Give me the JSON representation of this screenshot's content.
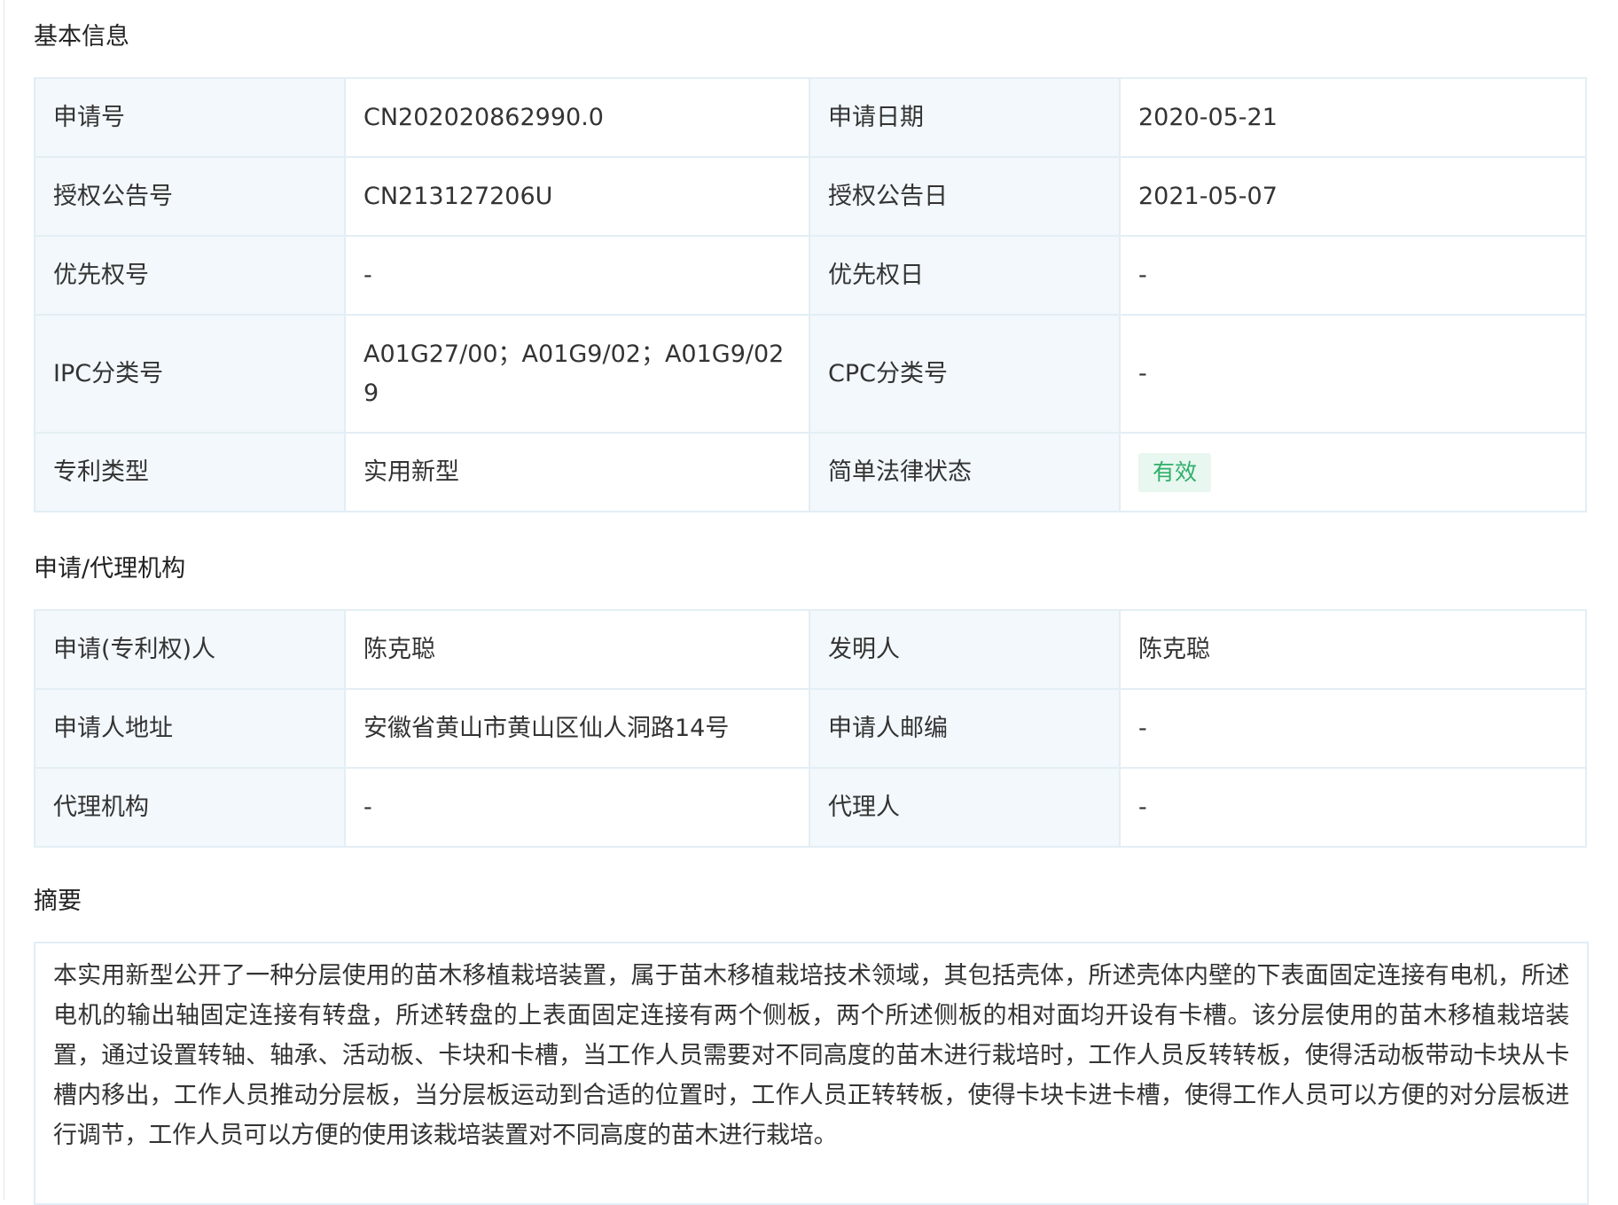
{
  "basic_info": {
    "title": "基本信息",
    "rows": [
      {
        "label1": "申请号",
        "value1": "CN202020862990.0",
        "label2": "申请日期",
        "value2": "2020-05-21"
      },
      {
        "label1": "授权公告号",
        "value1": "CN213127206U",
        "label2": "授权公告日",
        "value2": "2021-05-07"
      },
      {
        "label1": "优先权号",
        "value1": "-",
        "label2": "优先权日",
        "value2": "-"
      },
      {
        "label1": "IPC分类号",
        "value1": "A01G27/00；A01G9/02；A01G9/029",
        "label2": "CPC分类号",
        "value2": "-"
      },
      {
        "label1": "专利类型",
        "value1": "实用新型",
        "label2": "简单法律状态",
        "value2": "有效"
      }
    ],
    "status_color": "#2eaf6a",
    "status_bg": "#e8f7ef"
  },
  "agency": {
    "title": "申请/代理机构",
    "rows": [
      {
        "label1": "申请(专利权)人",
        "value1": "陈克聪",
        "label2": "发明人",
        "value2": "陈克聪"
      },
      {
        "label1": "申请人地址",
        "value1": "安徽省黄山市黄山区仙人洞路14号",
        "label2": "申请人邮编",
        "value2": "-"
      },
      {
        "label1": "代理机构",
        "value1": "-",
        "label2": "代理人",
        "value2": "-"
      }
    ]
  },
  "abstract": {
    "title": "摘要",
    "text": "本实用新型公开了一种分层使用的苗木移植栽培装置，属于苗木移植栽培技术领域，其包括壳体，所述壳体内壁的下表面固定连接有电机，所述电机的输出轴固定连接有转盘，所述转盘的上表面固定连接有两个侧板，两个所述侧板的相对面均开设有卡槽。该分层使用的苗木移植栽培装置，通过设置转轴、轴承、活动板、卡块和卡槽，当工作人员需要对不同高度的苗木进行栽培时，工作人员反转转板，使得活动板带动卡块从卡槽内移出，工作人员推动分层板，当分层板运动到合适的位置时，工作人员正转转板，使得卡块卡进卡槽，使得工作人员可以方便的对分层板进行调节，工作人员可以方便的使用该栽培装置对不同高度的苗木进行栽培。"
  },
  "colors": {
    "label_bg": "#f2f8fb",
    "border": "#e3eef5",
    "text": "#333333"
  }
}
